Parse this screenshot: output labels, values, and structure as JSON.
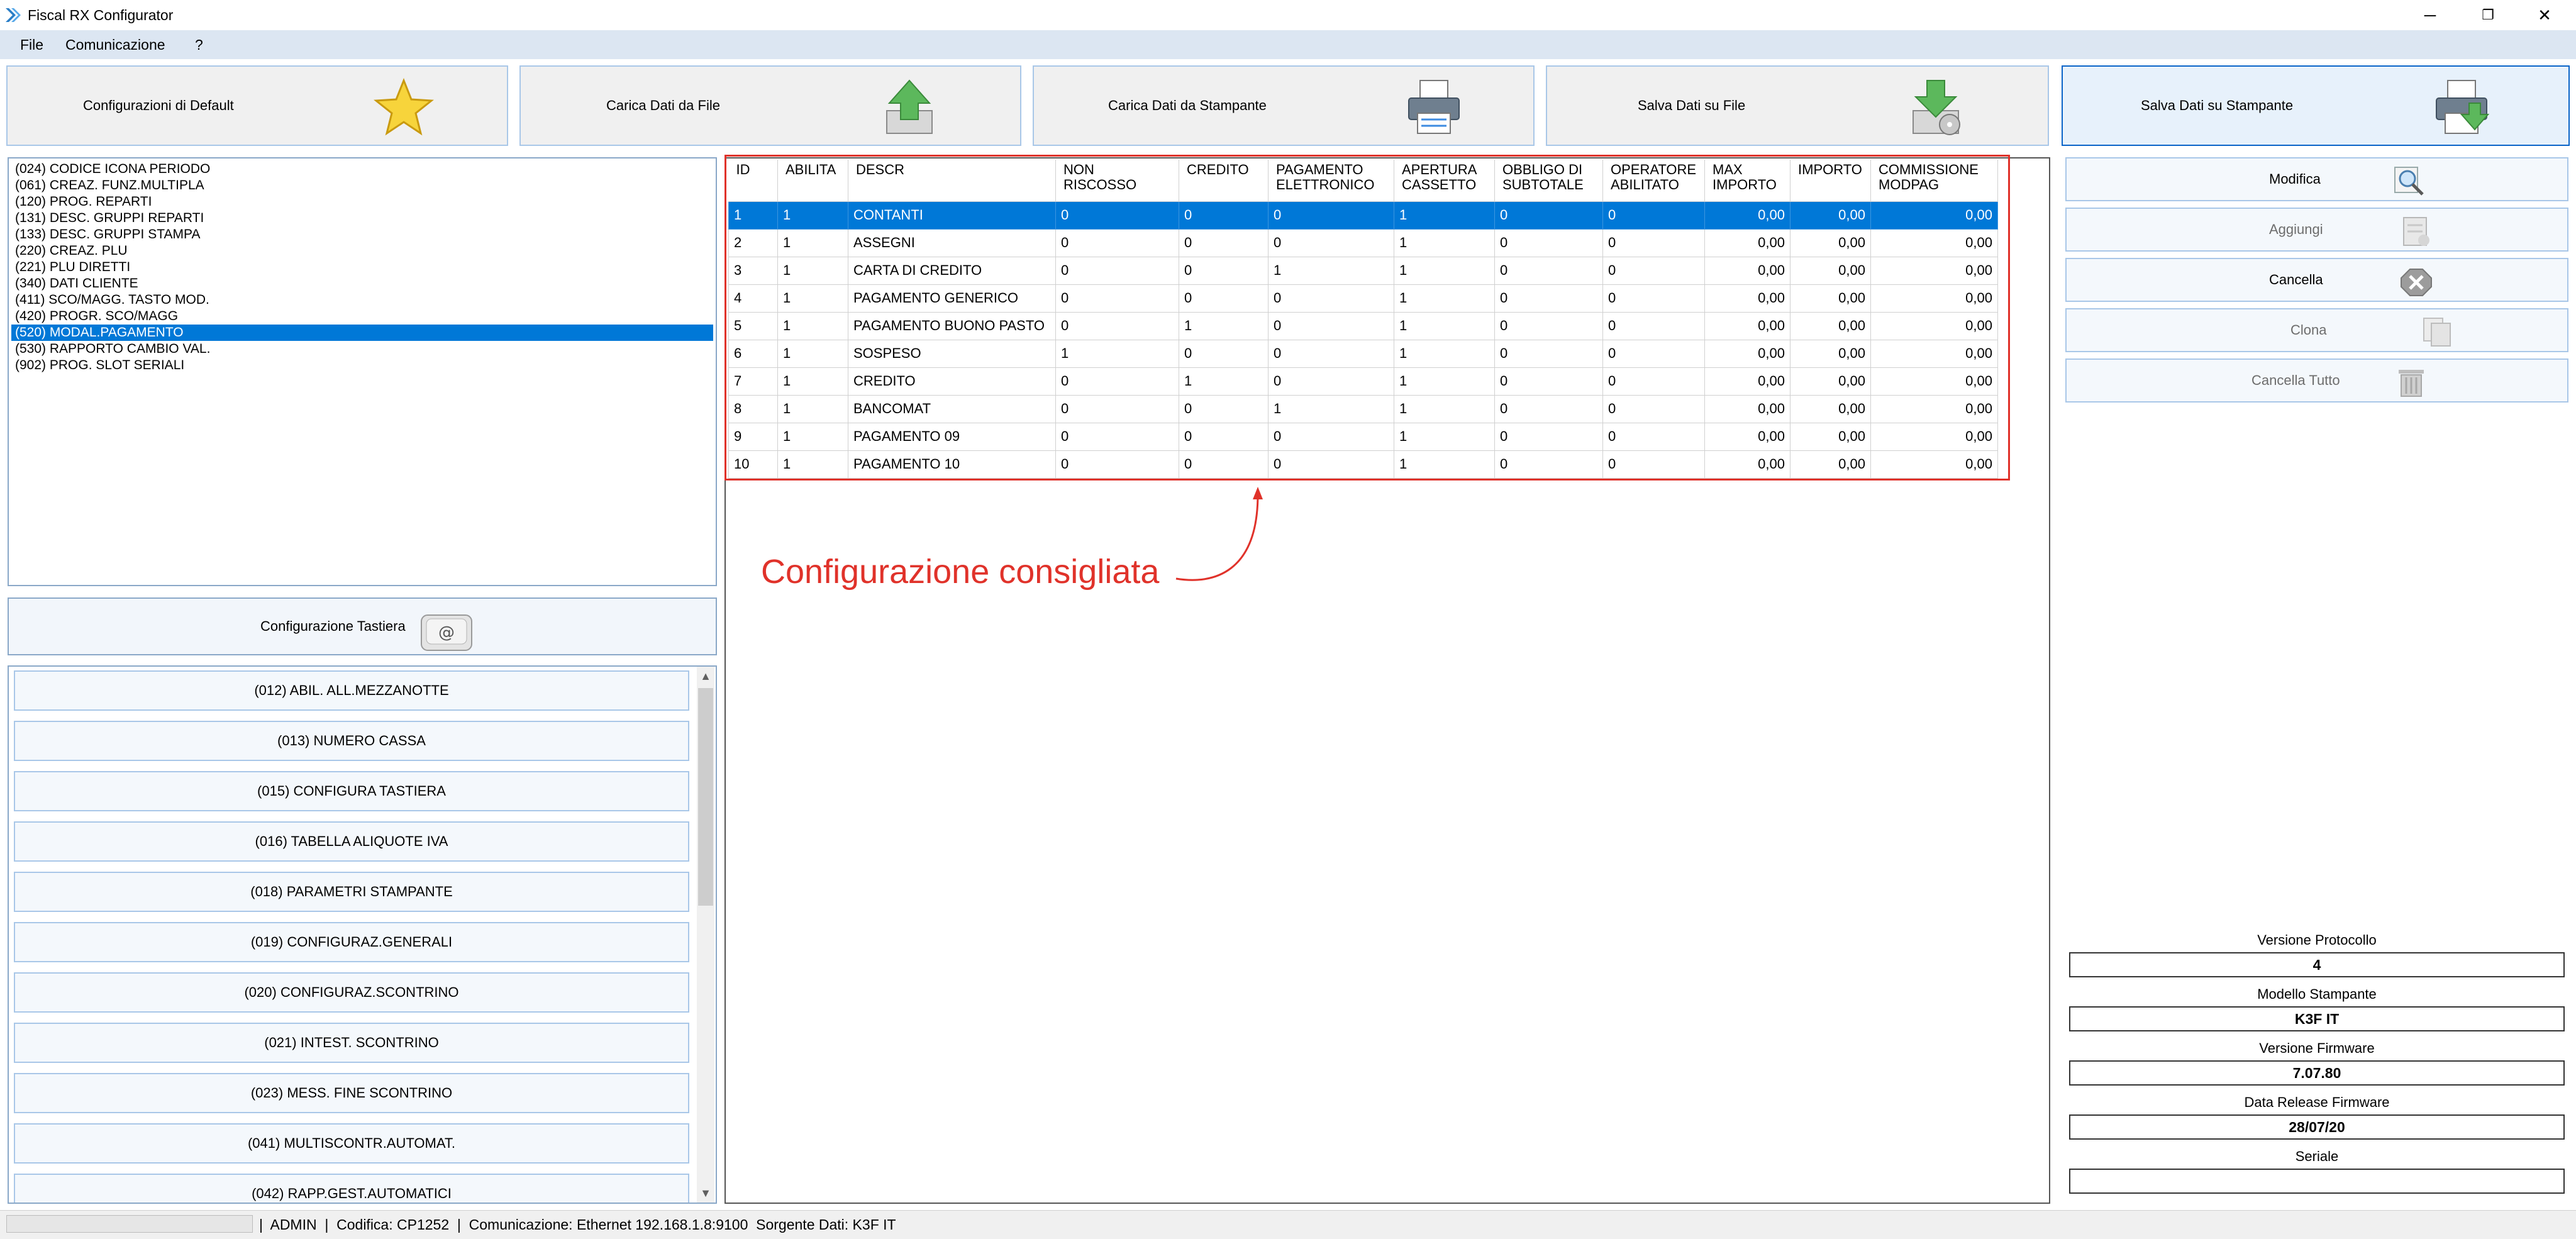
{
  "window": {
    "title": "Fiscal RX Configurator",
    "controls": {
      "minimize": "─",
      "restore": "❐",
      "close": "✕"
    }
  },
  "menu": [
    "File",
    "Comunicazione",
    "?"
  ],
  "toolbar": [
    {
      "label": "Configurazioni di Default",
      "icon": "star-icon"
    },
    {
      "label": "Carica Dati da File",
      "icon": "upload-box-icon"
    },
    {
      "label": "Carica Dati da Stampante",
      "icon": "printer-icon"
    },
    {
      "label": "Salva Dati su File",
      "icon": "save-disk-icon"
    },
    {
      "label": "Salva Dati su Stampante",
      "icon": "printer-download-icon"
    }
  ],
  "left_list": {
    "items": [
      "(024) CODICE ICONA PERIODO",
      "(061) CREAZ. FUNZ.MULTIPLA",
      "(120) PROG. REPARTI",
      "(131) DESC. GRUPPI REPARTI",
      "(133) DESC. GRUPPI STAMPA",
      "(220) CREAZ. PLU",
      "(221) PLU DIRETTI",
      "(340) DATI CLIENTE",
      "(411) SCO/MAGG. TASTO MOD.",
      "(420) PROGR. SCO/MAGG",
      "(520) MODAL.PAGAMENTO",
      "(530) RAPPORTO CAMBIO VAL.",
      "(902) PROG. SLOT SERIALI"
    ],
    "selected": "(520) MODAL.PAGAMENTO"
  },
  "keyboard_config": {
    "label": "Configurazione Tastiera"
  },
  "commands": [
    "(012) ABIL. ALL.MEZZANOTTE",
    "(013) NUMERO CASSA",
    "(015) CONFIGURA TASTIERA",
    "(016) TABELLA ALIQUOTE IVA",
    "(018) PARAMETRI STAMPANTE",
    "(019) CONFIGURAZ.GENERALI",
    "(020) CONFIGURAZ.SCONTRINO",
    "(021) INTEST. SCONTRINO",
    "(023) MESS. FINE SCONTRINO",
    "(041) MULTISCONTR.AUTOMAT.",
    "(042) RAPP.GEST.AUTOMATICI"
  ],
  "grid": {
    "columns": [
      "ID",
      "ABILITA",
      "DESCR",
      "NON\nRISCOSSO",
      "CREDITO",
      "PAGAMENTO\nELETTRONICO",
      "APERTURA\nCASSETTO",
      "OBBLIGO DI\nSUBTOTALE",
      "OPERATORE\nABILITATO",
      "MAX\nIMPORTO",
      "IMPORTO",
      "COMMISSIONE\nMODPAG"
    ],
    "rows": [
      [
        "1",
        "1",
        "CONTANTI",
        "0",
        "0",
        "0",
        "1",
        "0",
        "0",
        "0,00",
        "0,00",
        "0,00"
      ],
      [
        "2",
        "1",
        "ASSEGNI",
        "0",
        "0",
        "0",
        "1",
        "0",
        "0",
        "0,00",
        "0,00",
        "0,00"
      ],
      [
        "3",
        "1",
        "CARTA DI CREDITO",
        "0",
        "0",
        "1",
        "1",
        "0",
        "0",
        "0,00",
        "0,00",
        "0,00"
      ],
      [
        "4",
        "1",
        "PAGAMENTO GENERICO",
        "0",
        "0",
        "0",
        "1",
        "0",
        "0",
        "0,00",
        "0,00",
        "0,00"
      ],
      [
        "5",
        "1",
        "PAGAMENTO BUONO PASTO",
        "0",
        "1",
        "0",
        "1",
        "0",
        "0",
        "0,00",
        "0,00",
        "0,00"
      ],
      [
        "6",
        "1",
        "SOSPESO",
        "1",
        "0",
        "0",
        "1",
        "0",
        "0",
        "0,00",
        "0,00",
        "0,00"
      ],
      [
        "7",
        "1",
        "CREDITO",
        "0",
        "1",
        "0",
        "1",
        "0",
        "0",
        "0,00",
        "0,00",
        "0,00"
      ],
      [
        "8",
        "1",
        "BANCOMAT",
        "0",
        "0",
        "1",
        "1",
        "0",
        "0",
        "0,00",
        "0,00",
        "0,00"
      ],
      [
        "9",
        "1",
        "PAGAMENTO 09",
        "0",
        "0",
        "0",
        "1",
        "0",
        "0",
        "0,00",
        "0,00",
        "0,00"
      ],
      [
        "10",
        "1",
        "PAGAMENTO 10",
        "0",
        "0",
        "0",
        "1",
        "0",
        "0",
        "0,00",
        "0,00",
        "0,00"
      ]
    ],
    "selected_row": 0
  },
  "annotation": {
    "text": "Configurazione consigliata",
    "color": "#e0322a"
  },
  "actions": [
    {
      "label": "Modifica",
      "enabled": true,
      "icon": "magnifier-icon"
    },
    {
      "label": "Aggiungi",
      "enabled": false,
      "icon": "add-document-icon"
    },
    {
      "label": "Cancella",
      "enabled": true,
      "icon": "delete-x-icon"
    },
    {
      "label": "Clona",
      "enabled": false,
      "icon": "clone-documents-icon"
    },
    {
      "label": "Cancella Tutto",
      "enabled": false,
      "icon": "trash-icon"
    }
  ],
  "info": [
    {
      "label": "Versione Protocollo",
      "value": "4"
    },
    {
      "label": "Modello Stampante",
      "value": "K3F IT"
    },
    {
      "label": "Versione Firmware",
      "value": "7.07.80"
    },
    {
      "label": "Data Release Firmware",
      "value": "28/07/20"
    },
    {
      "label": "Seriale",
      "value": ""
    }
  ],
  "status": {
    "text": "|  ADMIN  |  Codifica: CP1252  |  Comunicazione: Ethernet 192.168.1.8:9100  Sorgente Dati: K3F IT"
  },
  "colors": {
    "accent": "#0078d7",
    "border": "#a9c7e8",
    "menu_bg": "#dce6f2"
  }
}
